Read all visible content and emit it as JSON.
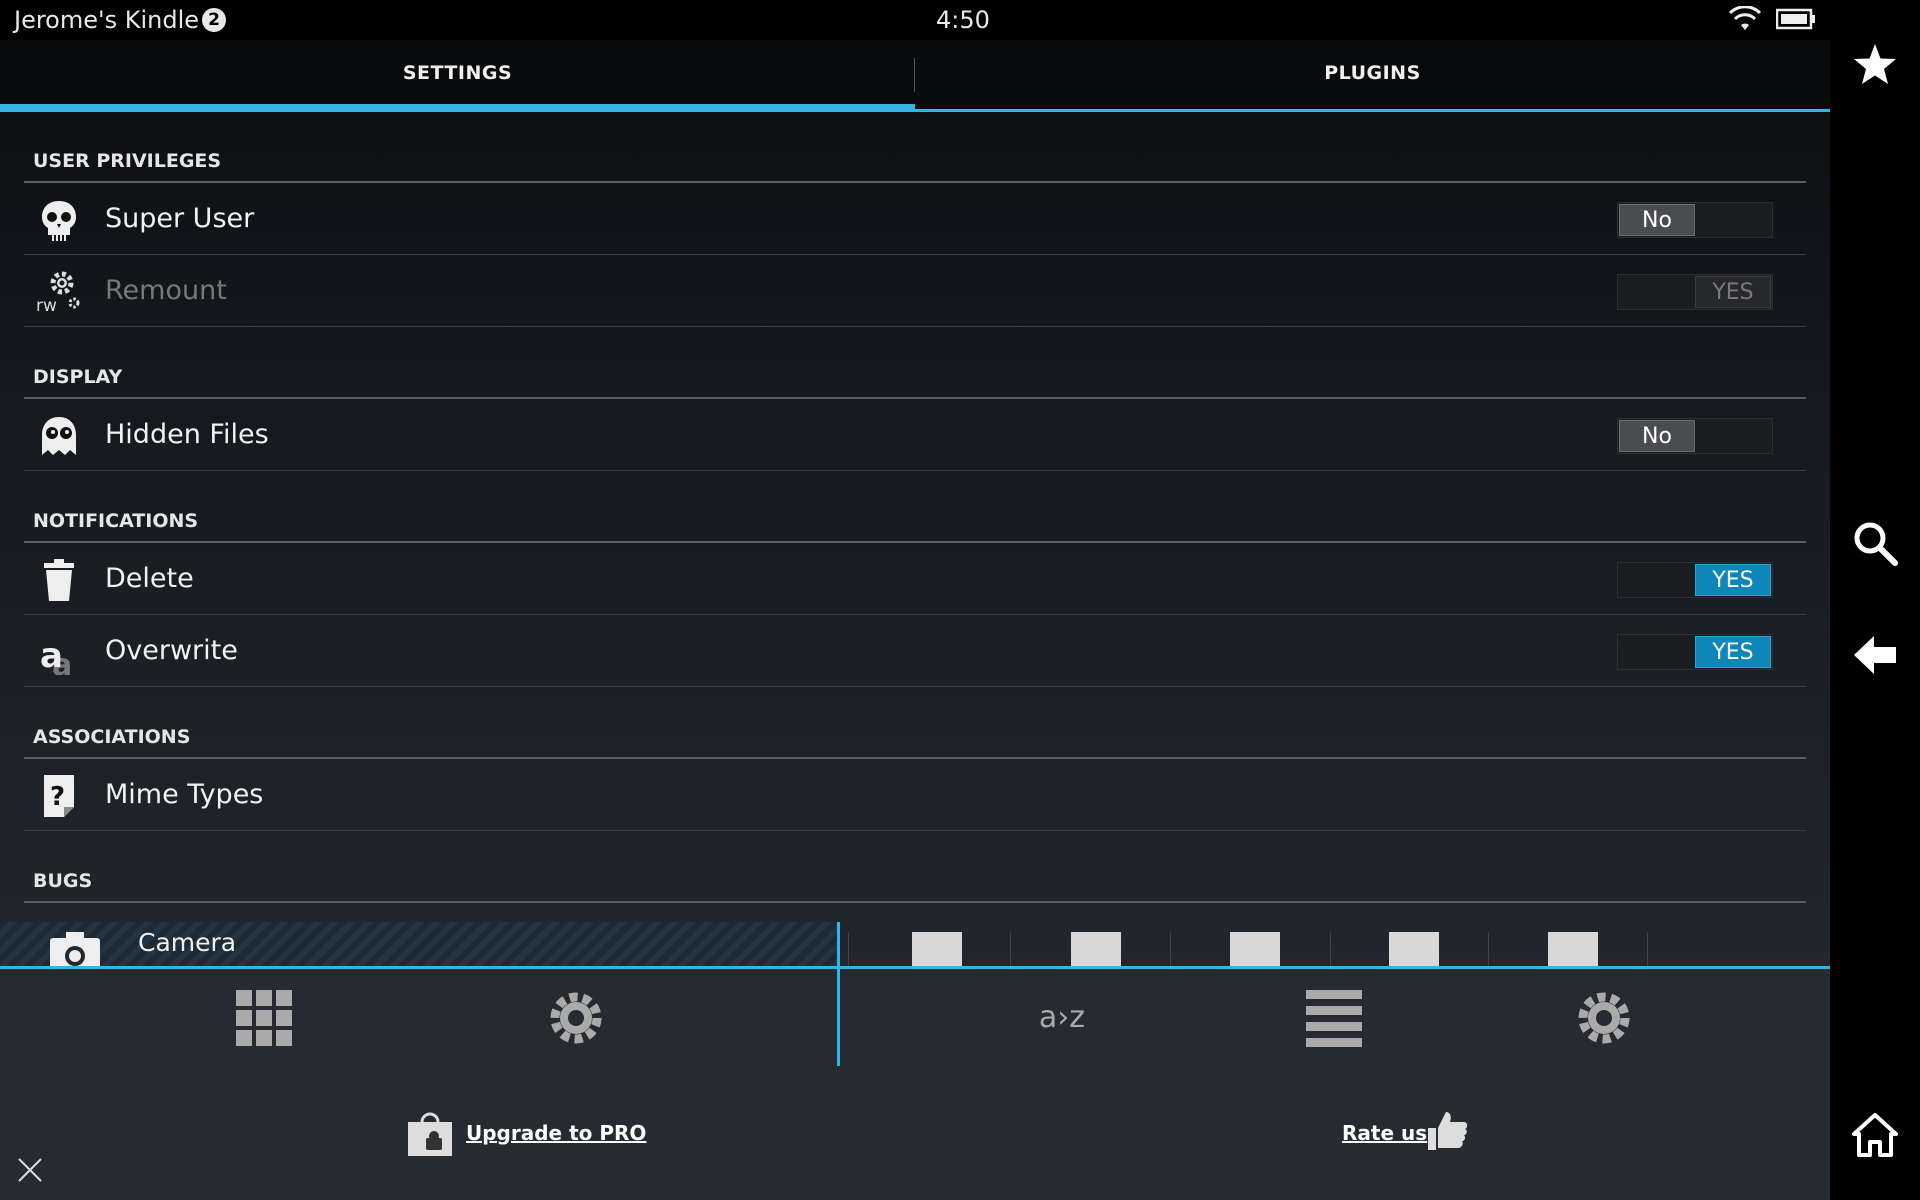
{
  "statusbar": {
    "device_name": "Jerome's Kindle",
    "notification_count": "2",
    "time": "4:50",
    "icons": [
      "wifi-icon",
      "battery-icon"
    ]
  },
  "tabs": [
    {
      "label": "SETTINGS",
      "active": true
    },
    {
      "label": "PLUGINS",
      "active": false
    }
  ],
  "sections": {
    "user_privileges": {
      "title": "USER PRIVILEGES",
      "super_user": {
        "label": "Super User",
        "toggle": "No",
        "state": "off",
        "icon": "skull-icon"
      },
      "remount": {
        "label": "Remount",
        "toggle": "YES",
        "state": "disabled",
        "icon": "rw-gear-icon"
      }
    },
    "display": {
      "title": "DISPLAY",
      "hidden_files": {
        "label": "Hidden Files",
        "toggle": "No",
        "state": "off",
        "icon": "ghost-icon"
      }
    },
    "notifications": {
      "title": "NOTIFICATIONS",
      "delete": {
        "label": "Delete",
        "toggle": "YES",
        "state": "on",
        "icon": "trash-icon"
      },
      "overwrite": {
        "label": "Overwrite",
        "toggle": "YES",
        "state": "on",
        "icon": "overwrite-a-icon"
      }
    },
    "associations": {
      "title": "ASSOCIATIONS",
      "mime_types": {
        "label": "Mime Types",
        "icon": "mime-question-icon"
      }
    },
    "bugs": {
      "title": "BUGS"
    }
  },
  "peek_row": {
    "label": "Camera",
    "icon": "camera-icon"
  },
  "toolbar": {
    "sort_label": "a›z",
    "icons": [
      "grid-icon",
      "gear-icon",
      "sort-az-icon",
      "list-icon",
      "gear-icon"
    ]
  },
  "footer": {
    "upgrade_label": "Upgrade to PRO",
    "rate_label": "Rate us"
  },
  "rail": {
    "icons": [
      "star-icon",
      "search-icon",
      "back-arrow-icon",
      "home-icon"
    ]
  },
  "colors": {
    "accent": "#33b5e5",
    "toggle_on": "#0f86b8",
    "background": "#000000"
  }
}
